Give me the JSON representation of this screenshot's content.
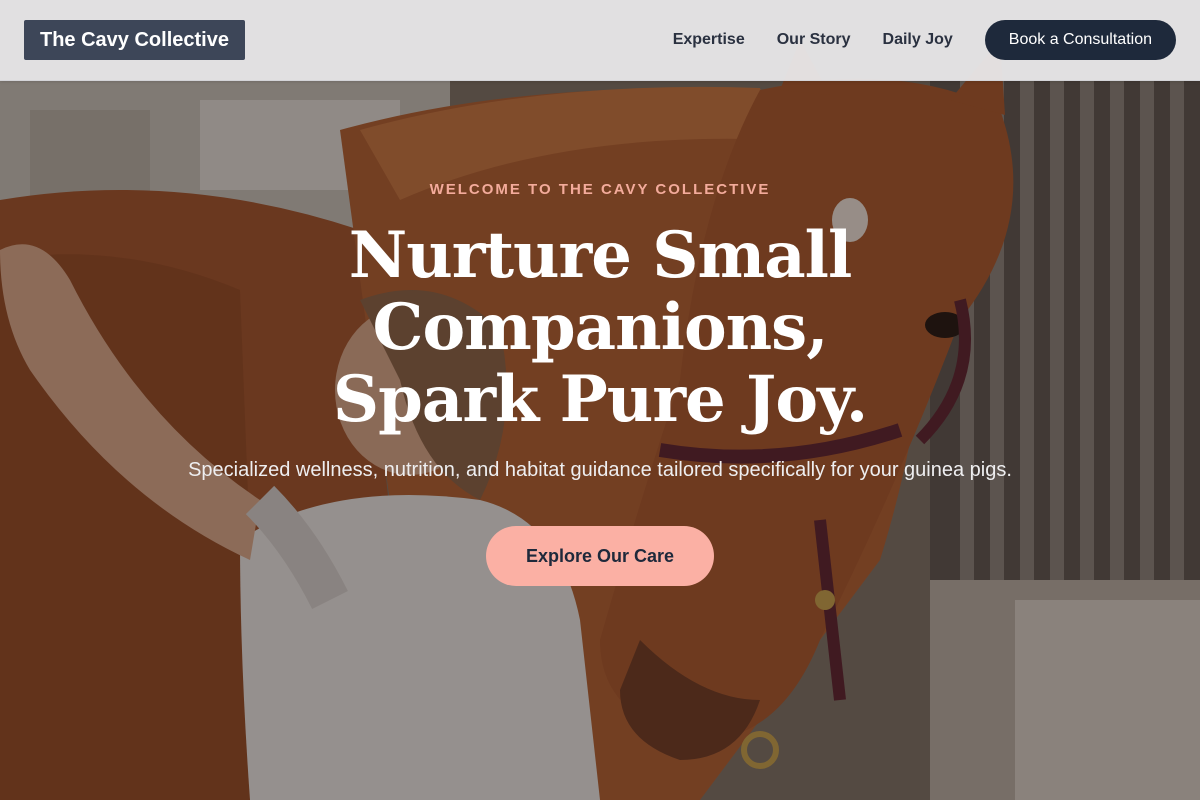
{
  "header": {
    "logo": "The Cavy Collective",
    "nav": [
      {
        "label": "Expertise"
      },
      {
        "label": "Our Story"
      },
      {
        "label": "Daily Joy"
      }
    ],
    "cta_label": "Book a Consultation"
  },
  "hero": {
    "eyebrow": "WELCOME TO THE CAVY COLLECTIVE",
    "headline_lines": [
      "Nurture Small",
      "Companions,",
      "Spark Pure Joy."
    ],
    "subtitle": "Specialized wellness, nutrition, and habitat guidance tailored specifically for your guinea pigs.",
    "cta_label": "Explore Our Care"
  },
  "colors": {
    "header_bg": "#ececee",
    "logo_bg": "#3d4658",
    "nav_text": "#2a3140",
    "nav_cta_bg": "#1e293b",
    "eyebrow": "#f3ab9b",
    "hero_cta_bg": "#fbb0a4",
    "hero_cta_text": "#1e293b"
  },
  "background_image": {
    "subject": "woman grooming a chestnut horse in a stable"
  }
}
